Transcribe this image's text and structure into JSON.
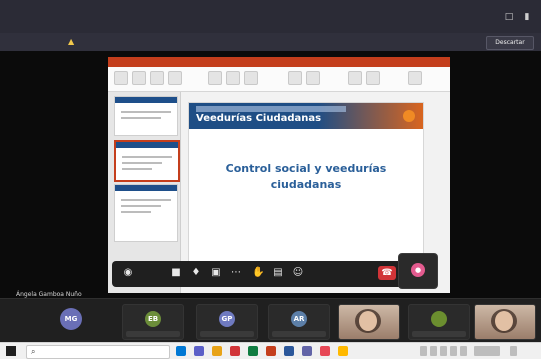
{
  "banner": {
    "text": "",
    "dismiss_label": "Descartar"
  },
  "slide": {
    "title": "Veedurías Ciudadanas",
    "body_title": "Control social y veedurías ciudadanas"
  },
  "presenter": {
    "name": "Ángela Gamboa Nuño"
  },
  "participants": [
    {
      "initials": "MG",
      "color": "#6a6fb6"
    },
    {
      "initials": "EB",
      "color": "#6c8e3a"
    },
    {
      "initials": "GP",
      "color": "#6f7ac0"
    },
    {
      "initials": "AR",
      "color": "#5c7fa8"
    },
    {
      "initials": "",
      "color": "#6b8e2f"
    }
  ],
  "controls": {
    "timer": ""
  },
  "colors": {
    "brand_blue": "#1f4e85",
    "accent_orange": "#d9651f",
    "hangup_red": "#d13438",
    "ppt_red": "#c43e1c"
  },
  "icons": {
    "warning": "warning-icon",
    "search": "search-icon",
    "camera": "camera-icon",
    "microphone": "microphone-icon",
    "share": "share-screen-icon",
    "more": "more-icon",
    "hand": "raise-hand-icon",
    "chat": "chat-icon",
    "people": "people-icon",
    "hangup": "hangup-icon"
  }
}
